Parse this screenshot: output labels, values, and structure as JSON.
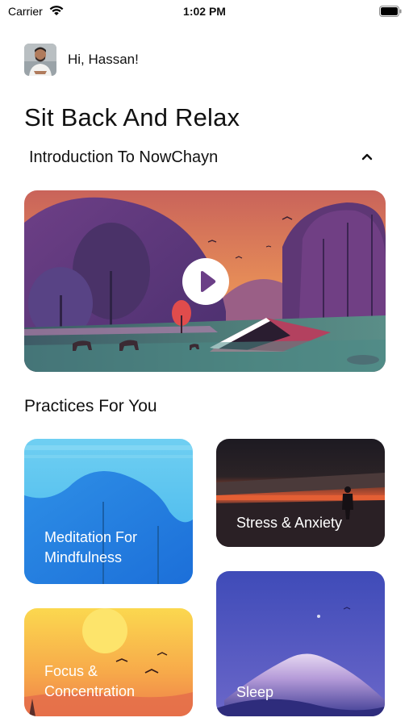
{
  "status_bar": {
    "carrier": "Carrier",
    "time": "1:02 PM"
  },
  "header": {
    "greeting": "Hi, Hassan!"
  },
  "title": "Sit Back And Relax",
  "intro": {
    "label": "Introduction To NowChayn",
    "icon": "chevron-up-icon"
  },
  "practices": {
    "title": "Practices For You",
    "items": [
      {
        "label": "Meditation For Mindfulness"
      },
      {
        "label": "Stress & Anxiety"
      },
      {
        "label": "Focus & Concentration"
      },
      {
        "label": "Sleep"
      }
    ]
  },
  "colors": {
    "text": "#111111",
    "background": "#ffffff"
  }
}
